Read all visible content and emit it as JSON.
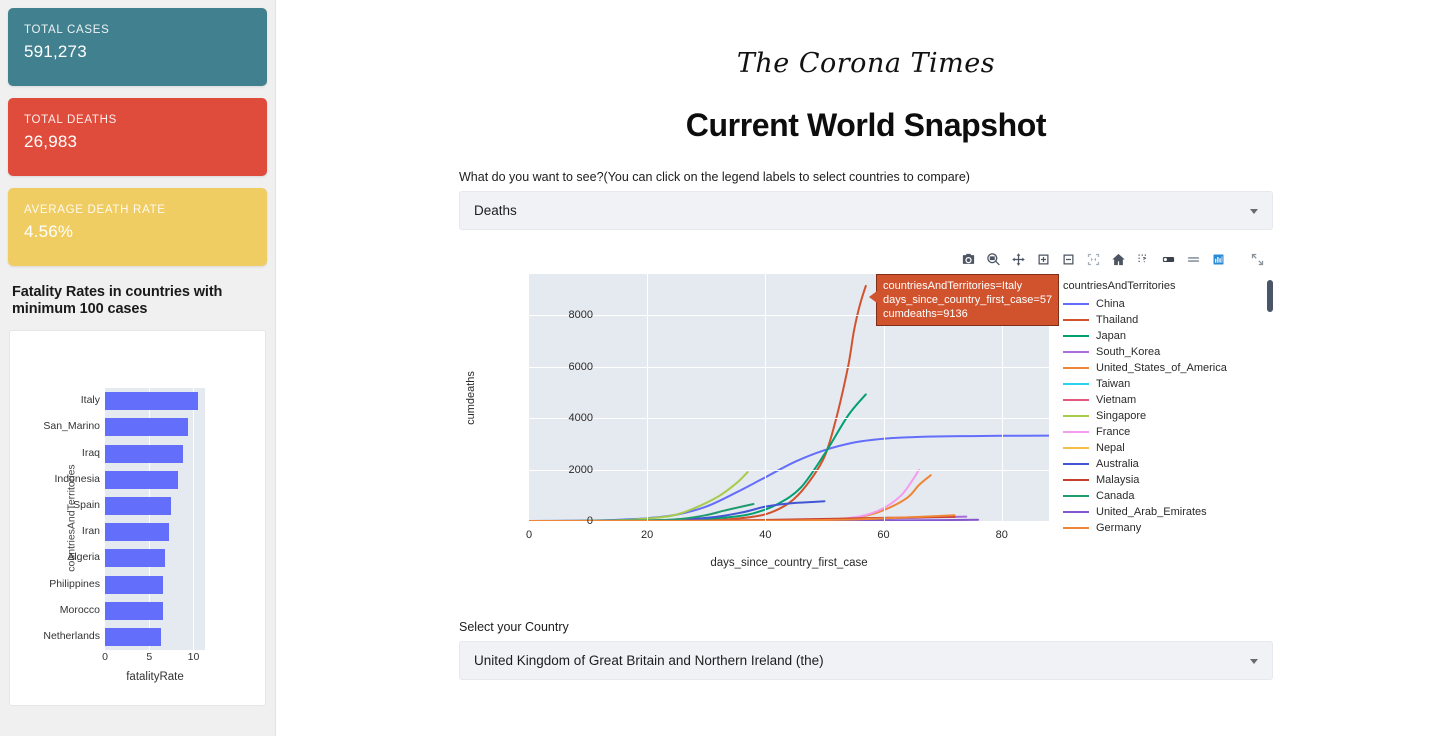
{
  "sidebar": {
    "stats": [
      {
        "label": "TOTAL CASES",
        "value": "591,273",
        "color": "#41808e"
      },
      {
        "label": "TOTAL DEATHS",
        "value": "26,983",
        "color": "#e04c3c"
      },
      {
        "label": "AVERAGE DEATH RATE",
        "value": "4.56%",
        "color": "#f0cd63"
      }
    ],
    "chart_heading": "Fatality Rates in countries with minimum 100 cases"
  },
  "header": {
    "masthead": "The Corona Times",
    "page_title": "Current World Snapshot"
  },
  "metric_select": {
    "label": "What do you want to see?(You can click on the legend labels to select countries to compare)",
    "value": "Deaths",
    "caret": "chevron-down-icon"
  },
  "country_select": {
    "label": "Select your Country",
    "value": "United Kingdom of Great Britain and Northern Ireland (the)",
    "caret": "chevron-down-icon"
  },
  "modebar": {
    "buttons": [
      {
        "name": "download-plot-png-icon",
        "title": "Download plot as a png"
      },
      {
        "name": "zoom-icon",
        "title": "Zoom"
      },
      {
        "name": "pan-icon",
        "title": "Pan"
      },
      {
        "name": "zoom-in-icon",
        "title": "Zoom in"
      },
      {
        "name": "zoom-out-icon",
        "title": "Zoom out"
      },
      {
        "name": "autoscale-icon",
        "title": "Autoscale"
      },
      {
        "name": "reset-axes-icon",
        "title": "Reset axes"
      },
      {
        "name": "toggle-spike-lines-icon",
        "title": "Toggle Spike Lines"
      },
      {
        "name": "hover-closest-icon",
        "title": "Show closest data on hover"
      },
      {
        "name": "hover-compare-icon",
        "title": "Compare data on hover"
      },
      {
        "name": "plotly-logo-icon",
        "title": "Produced with Plotly",
        "active": true
      },
      {
        "name": "fullscreen-icon",
        "title": "Expand"
      }
    ]
  },
  "tooltip": {
    "lines": [
      "countriesAndTerritories=Italy",
      "days_since_country_first_case=57",
      "cumdeaths=9136"
    ],
    "bg_color": "#d1532e"
  },
  "chart_data": [
    {
      "id": "fatality-bar-chart",
      "type": "bar",
      "orientation": "horizontal",
      "title": "Fatality Rates in countries with minimum 100 cases",
      "xlabel": "fatalityRate",
      "ylabel": "countriesAndTerritories",
      "categories": [
        "Italy",
        "San_Marino",
        "Iraq",
        "Indonesia",
        "Spain",
        "Iran",
        "Algeria",
        "Philippines",
        "Morocco",
        "Netherlands"
      ],
      "values": [
        10.5,
        9.4,
        8.8,
        8.2,
        7.5,
        7.2,
        6.8,
        6.6,
        6.6,
        6.3
      ],
      "xlim": [
        0,
        11.3
      ],
      "xticks": [
        0,
        5,
        10
      ],
      "bar_color": "#636efa",
      "grid": true,
      "plot_bg": "#e5e9f0"
    },
    {
      "id": "cumdeaths-line-chart",
      "type": "line",
      "xlabel": "days_since_country_first_case",
      "ylabel": "cumdeaths",
      "xlim": [
        0,
        88
      ],
      "ylim": [
        0,
        9600
      ],
      "xticks": [
        0,
        20,
        40,
        60,
        80
      ],
      "yticks": [
        0,
        2000,
        4000,
        6000,
        8000
      ],
      "legend_title": "countriesAndTerritories",
      "legend_position": "right",
      "grid": true,
      "plot_bg": "#e5e9f0",
      "series": [
        {
          "name": "China",
          "color": "#636efa",
          "x": [
            0,
            8,
            14,
            20,
            25,
            30,
            35,
            40,
            45,
            50,
            55,
            60,
            65,
            70,
            75,
            80,
            88
          ],
          "y": [
            0,
            10,
            40,
            110,
            250,
            560,
            1100,
            1700,
            2300,
            2750,
            3050,
            3200,
            3260,
            3290,
            3300,
            3310,
            3320
          ]
        },
        {
          "name": "Thailand",
          "color": "#d1532e",
          "x": [
            0,
            18,
            25,
            30,
            35,
            40,
            44,
            47,
            50,
            52,
            54,
            55,
            56,
            57
          ],
          "y": [
            0,
            2,
            8,
            30,
            90,
            260,
            700,
            1400,
            2500,
            4000,
            6000,
            7400,
            8400,
            9136
          ]
        },
        {
          "name": "Japan",
          "color": "#00a070",
          "x": [
            0,
            14,
            22,
            28,
            34,
            38,
            42,
            46,
            50,
            54,
            57
          ],
          "y": [
            0,
            5,
            25,
            70,
            150,
            300,
            650,
            1300,
            2600,
            4100,
            4920
          ]
        },
        {
          "name": "South_Korea",
          "color": "#a96ddb",
          "x": [
            0,
            20,
            35,
            48,
            58,
            66,
            74
          ],
          "y": [
            0,
            4,
            14,
            40,
            80,
            130,
            170
          ]
        },
        {
          "name": "United_States_of_America",
          "color": "#ef8636",
          "x": [
            0,
            40,
            50,
            56,
            60,
            64,
            66,
            68
          ],
          "y": [
            0,
            8,
            40,
            160,
            420,
            900,
            1400,
            1780
          ]
        },
        {
          "name": "Taiwan",
          "color": "#29d3f0",
          "x": [
            0,
            30,
            50,
            66,
            74
          ],
          "y": [
            0,
            2,
            6,
            12,
            20
          ]
        },
        {
          "name": "Vietnam",
          "color": "#e4587c",
          "x": [
            0,
            30,
            50,
            66,
            74
          ],
          "y": [
            0,
            0,
            2,
            4,
            6
          ]
        },
        {
          "name": "Singapore",
          "color": "#a8cc4a",
          "x": [
            0,
            10,
            18,
            24,
            28,
            32,
            35,
            37
          ],
          "y": [
            0,
            10,
            60,
            200,
            500,
            950,
            1450,
            1900
          ]
        },
        {
          "name": "France",
          "color": "#f39cf0",
          "x": [
            0,
            40,
            50,
            56,
            60,
            63,
            65,
            66
          ],
          "y": [
            0,
            6,
            40,
            180,
            500,
            1000,
            1620,
            1990
          ]
        },
        {
          "name": "Nepal",
          "color": "#f5bd4b",
          "x": [
            0,
            30,
            50,
            66,
            74
          ],
          "y": [
            0,
            1,
            3,
            6,
            9
          ]
        },
        {
          "name": "Australia",
          "color": "#4256d3",
          "x": [
            0,
            20,
            30,
            36,
            40,
            44,
            48,
            50
          ],
          "y": [
            0,
            20,
            120,
            330,
            560,
            680,
            740,
            770
          ]
        },
        {
          "name": "Malaysia",
          "color": "#c5402c",
          "x": [
            0,
            22,
            32,
            42,
            52,
            62,
            72
          ],
          "y": [
            0,
            4,
            18,
            45,
            90,
            130,
            165
          ]
        },
        {
          "name": "Canada",
          "color": "#1f9c6b",
          "x": [
            0,
            20,
            26,
            30,
            33,
            36,
            38
          ],
          "y": [
            0,
            20,
            90,
            230,
            400,
            560,
            660
          ]
        },
        {
          "name": "United_Arab_Emirates",
          "color": "#8457cf",
          "x": [
            0,
            25,
            45,
            60,
            70,
            76
          ],
          "y": [
            0,
            2,
            8,
            20,
            36,
            50
          ]
        },
        {
          "name": "Germany",
          "color": "#ef8636",
          "x": [
            0,
            30,
            45,
            55,
            62,
            68,
            72
          ],
          "y": [
            0,
            4,
            20,
            60,
            120,
            180,
            220
          ]
        }
      ]
    }
  ],
  "legend": {
    "title": "countriesAndTerritories",
    "items": [
      {
        "label": "China",
        "color": "#636efa"
      },
      {
        "label": "Thailand",
        "color": "#d1532e"
      },
      {
        "label": "Japan",
        "color": "#00a070"
      },
      {
        "label": "South_Korea",
        "color": "#a96ddb"
      },
      {
        "label": "United_States_of_America",
        "color": "#ef8636"
      },
      {
        "label": "Taiwan",
        "color": "#29d3f0"
      },
      {
        "label": "Vietnam",
        "color": "#e4587c"
      },
      {
        "label": "Singapore",
        "color": "#a8cc4a"
      },
      {
        "label": "France",
        "color": "#f39cf0"
      },
      {
        "label": "Nepal",
        "color": "#f5bd4b"
      },
      {
        "label": "Australia",
        "color": "#4256d3"
      },
      {
        "label": "Malaysia",
        "color": "#c5402c"
      },
      {
        "label": "Canada",
        "color": "#1f9c6b"
      },
      {
        "label": "United_Arab_Emirates",
        "color": "#8457cf"
      },
      {
        "label": "Germany",
        "color": "#ef8636"
      }
    ]
  }
}
